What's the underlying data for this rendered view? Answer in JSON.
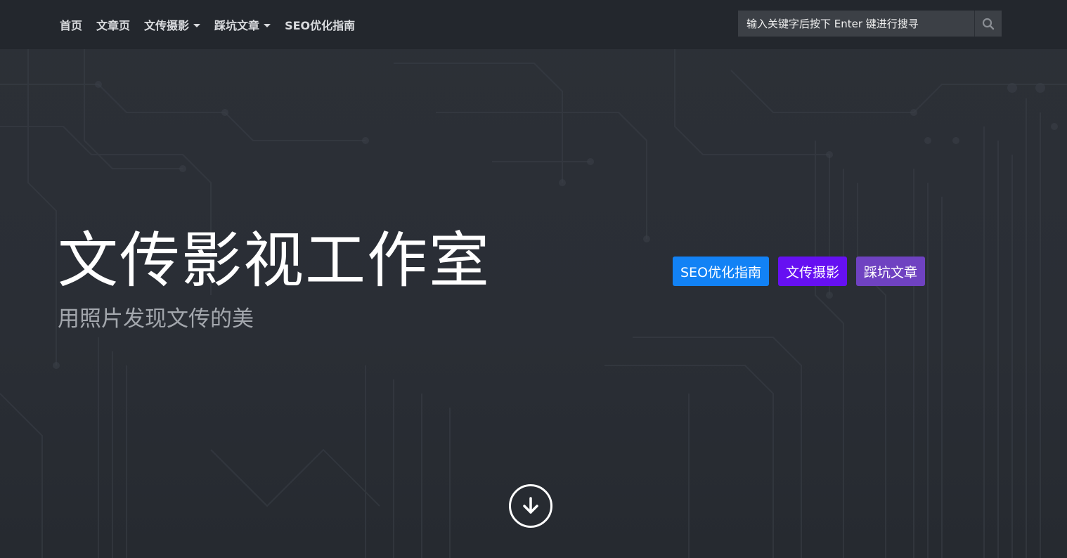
{
  "nav": {
    "items": [
      {
        "label": "首页",
        "dropdown": false
      },
      {
        "label": "文章页",
        "dropdown": false
      },
      {
        "label": "文传摄影",
        "dropdown": true
      },
      {
        "label": "踩坑文章",
        "dropdown": true
      },
      {
        "label": "SEO优化指南",
        "dropdown": false
      }
    ]
  },
  "search": {
    "placeholder": "输入关键字后按下 Enter 键进行搜寻",
    "icon": "search-icon"
  },
  "hero": {
    "title": "文传影视工作室",
    "subtitle": "用照片发现文传的美"
  },
  "tags": [
    {
      "label": "SEO优化指南",
      "color": "#1282f5"
    },
    {
      "label": "文传摄影",
      "color": "#6610f2"
    },
    {
      "label": "踩坑文章",
      "color": "#6f42c1"
    }
  ],
  "scroll": {
    "icon": "arrow-down-circle-icon"
  },
  "colors": {
    "navbar": "#23272d",
    "background": "#2b2f36",
    "text": "#ffffff"
  }
}
